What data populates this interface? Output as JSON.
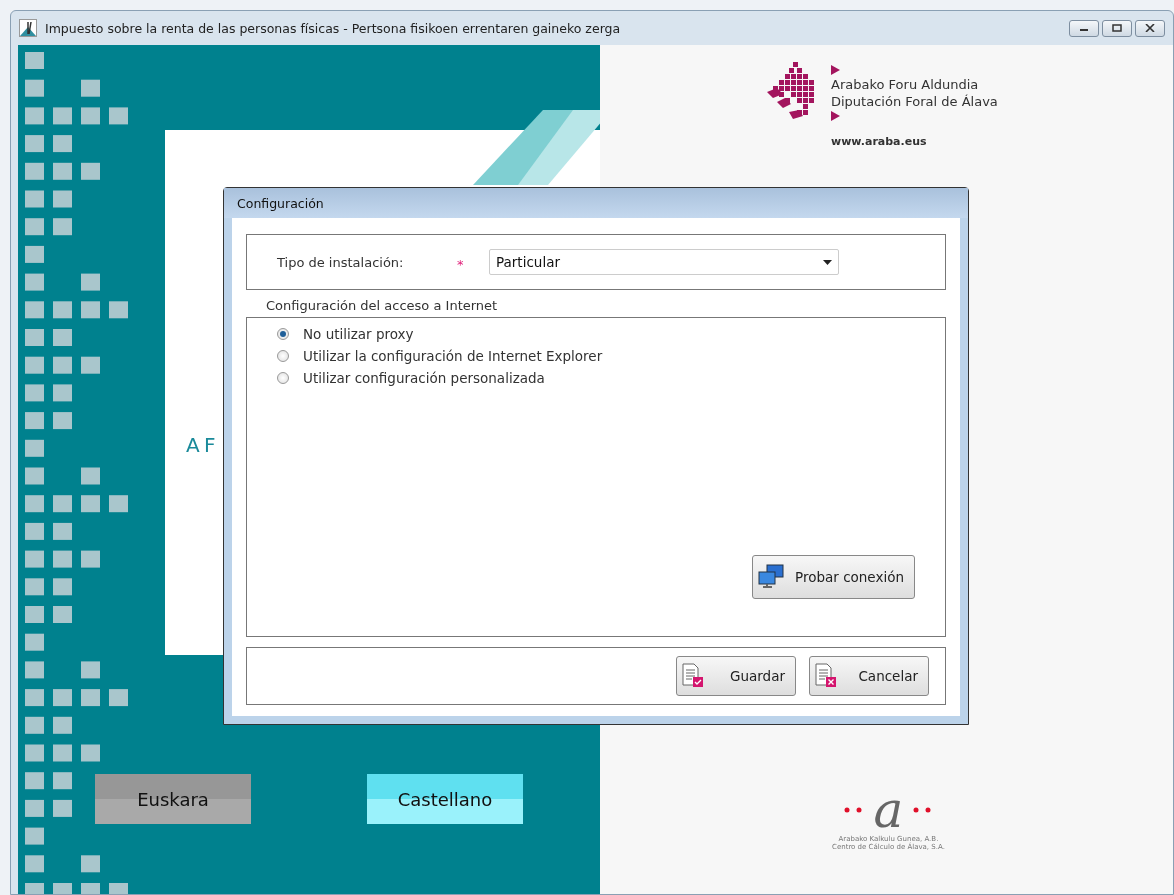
{
  "window": {
    "title": "Impuesto sobre la renta de las personas físicas -  Pertsona fisikoen errentaren gaineko zerga"
  },
  "splash": {
    "heading_fragment": "A F",
    "logo": {
      "lines": [
        "Arabako Foru Aldundia",
        "Diputación Foral de Álava"
      ],
      "url": "www.araba.eus"
    },
    "language_buttons": [
      {
        "label": "Euskara",
        "selected": false
      },
      {
        "label": "Castellano",
        "selected": true
      }
    ],
    "footer_logo": {
      "mark": "a",
      "lines": [
        "Arabako Kalkulu Gunea, A.B.",
        "Centro de Cálculo de Álava, S.A."
      ]
    }
  },
  "dialog": {
    "title": "Configuración",
    "installation_type": {
      "label": "Tipo de instalación:",
      "required_mark": "*",
      "value": "Particular"
    },
    "internet_group": {
      "title": "Configuración del acceso a Internet",
      "options": [
        {
          "label": "No utilizar proxy",
          "selected": true
        },
        {
          "label": "Utilizar la configuración de Internet Explorer",
          "selected": false
        },
        {
          "label": "Utilizar configuración personalizada",
          "selected": false
        }
      ],
      "test_button": "Probar conexión"
    },
    "buttons": [
      {
        "label": "Guardar",
        "kind": "save"
      },
      {
        "label": "Cancelar",
        "kind": "cancel"
      }
    ]
  }
}
